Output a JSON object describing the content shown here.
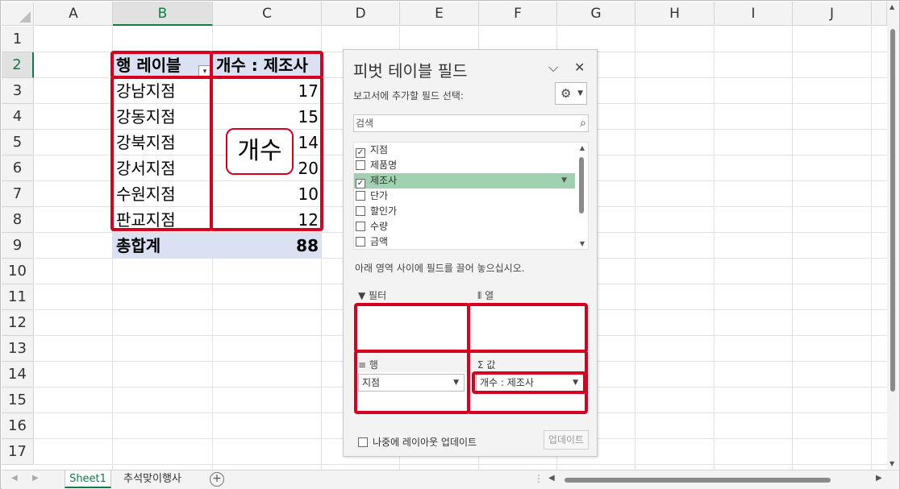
{
  "sheet": {
    "columns": [
      "A",
      "B",
      "C",
      "D",
      "E",
      "F",
      "G",
      "H",
      "I",
      "J"
    ],
    "rows": [
      "1",
      "2",
      "3",
      "4",
      "5",
      "6",
      "7",
      "8",
      "9",
      "10",
      "11",
      "12",
      "13",
      "14",
      "15",
      "16",
      "17"
    ],
    "active_column": "B",
    "active_row": "2"
  },
  "pivot": {
    "row_label_header": "행 레이블",
    "value_header": "개수 : 제조사",
    "rows": [
      {
        "label": "강남지점",
        "value": "17"
      },
      {
        "label": "강동지점",
        "value": "15"
      },
      {
        "label": "강북지점",
        "value": "14"
      },
      {
        "label": "강서지점",
        "value": "20"
      },
      {
        "label": "수원지점",
        "value": "10"
      },
      {
        "label": "판교지점",
        "value": "12"
      }
    ],
    "total_label": "총합계",
    "total_value": "88",
    "annotation": "개수"
  },
  "panel": {
    "title": "피벗 테이블 필드",
    "subtitle": "보고서에 추가할 필드 선택:",
    "search_placeholder": "검색",
    "fields": [
      {
        "name": "지점",
        "checked": true
      },
      {
        "name": "제품명",
        "checked": false
      },
      {
        "name": "제조사",
        "checked": true
      },
      {
        "name": "단가",
        "checked": false
      },
      {
        "name": "할인가",
        "checked": false
      },
      {
        "name": "수량",
        "checked": false
      },
      {
        "name": "금액",
        "checked": false
      }
    ],
    "hint": "아래 영역 사이에 필드를 끌어 놓으십시오.",
    "areas": {
      "filter_label": "필터",
      "columns_label": "열",
      "rows_label": "행",
      "values_label": "값",
      "rows_field": "지점",
      "values_field": "개수 : 제조사"
    },
    "defer_label": "나중에 레이아웃 업데이트",
    "update_label": "업데이트"
  },
  "tabs": {
    "sheets": [
      "Sheet1",
      "추석맞이행사"
    ],
    "active": "Sheet1"
  },
  "colors": {
    "excel_green": "#107c41",
    "highlight_red": "#d7001f",
    "pivot_header": "#d9e1f2",
    "selected_field": "#a0d2b1"
  }
}
